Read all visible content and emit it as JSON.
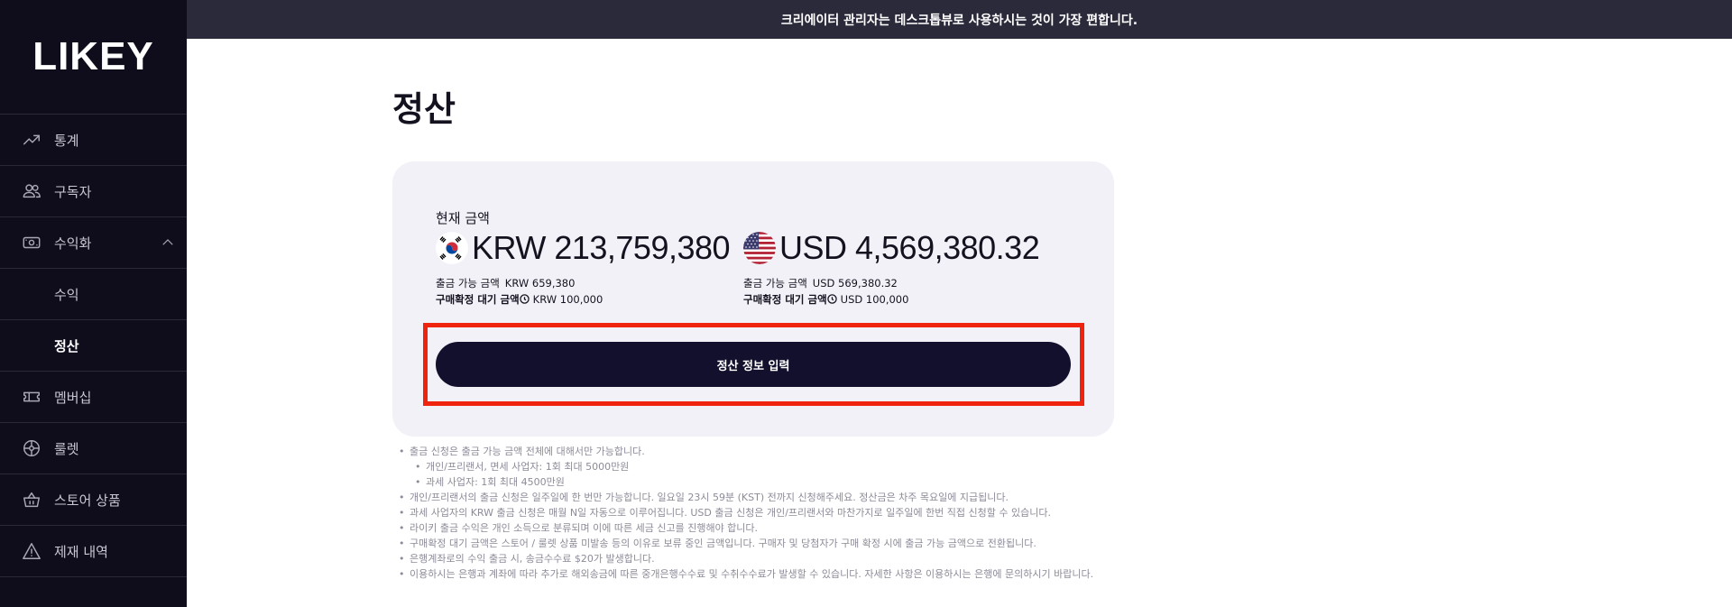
{
  "sidebar": {
    "logo": "LIKEY",
    "items": [
      {
        "label": "통계",
        "icon": "trending-up-icon"
      },
      {
        "label": "구독자",
        "icon": "users-icon"
      },
      {
        "label": "수익화",
        "icon": "money-icon",
        "expanded": true
      },
      {
        "label": "수익",
        "sub": true
      },
      {
        "label": "정산",
        "sub": true,
        "active": true
      },
      {
        "label": "멤버십",
        "icon": "ticket-icon"
      },
      {
        "label": "룰렛",
        "icon": "roulette-icon"
      },
      {
        "label": "스토어 상품",
        "icon": "basket-icon"
      },
      {
        "label": "제재 내역",
        "icon": "warning-icon"
      }
    ]
  },
  "banner": {
    "text": "크리에이터 관리자는 데스크톱뷰로 사용하시는 것이 가장 편합니다."
  },
  "page": {
    "title": "정산"
  },
  "balance": {
    "label": "현재 금액",
    "krw": {
      "amount": "KRW 213,759,380",
      "withdrawable_label": "출금 가능 금액",
      "withdrawable_value": "KRW 659,380",
      "pending_label": "구매확정 대기 금액",
      "pending_value": "KRW 100,000"
    },
    "usd": {
      "amount": "USD 4,569,380.32",
      "withdrawable_label": "출금 가능 금액",
      "withdrawable_value": "USD 569,380.32",
      "pending_label": "구매확정 대기 금액",
      "pending_value": "USD 100,000"
    }
  },
  "cta": {
    "label": "정산 정보 입력"
  },
  "notes": [
    "출금 신청은 출금 가능 금액 전체에 대해서만 가능합니다.",
    "개인/프리랜서, 면세 사업자: 1회 최대 5000만원",
    "과세 사업자: 1회 최대 4500만원",
    "개인/프리랜서의 출금 신청은 일주일에 한 번만 가능합니다. 일요일 23시 59분 (KST) 전까지 신청해주세요. 정산금은 차주 목요일에 지급됩니다.",
    "과세 사업자의 KRW 출금 신청은 매월 N일 자동으로 이루어집니다. USD 출금 신청은 개인/프리랜서와 마찬가지로 일주일에 한번 직접 신청할 수 있습니다.",
    "라이키 출금 수익은 개인 소득으로 분류되며 이에 따른 세금 신고를 진행해야 합니다.",
    "구매확정 대기 금액은 스토어 / 룰렛 상품 미발송 등의 이유로 보류 중인 금액입니다. 구매자 및 당첨자가 구매 확정 시에 출금 가능 금액으로 전환됩니다.",
    "은행계좌로의 수익 출금 시, 송금수수료 $20가 발생합니다.",
    "이용하시는 은행과 계좌에 따라 추가로 해외송금에 따른 중개은행수수료 및 수취수수료가 발생할 수 있습니다. 자세한 사항은 이용하시는 은행에 문의하시기 바랍니다."
  ],
  "colors": {
    "accent": "#13102e",
    "highlight": "#f0240e",
    "sidebar_bg": "#0f0d1c",
    "card_bg": "#f2f1f7"
  }
}
